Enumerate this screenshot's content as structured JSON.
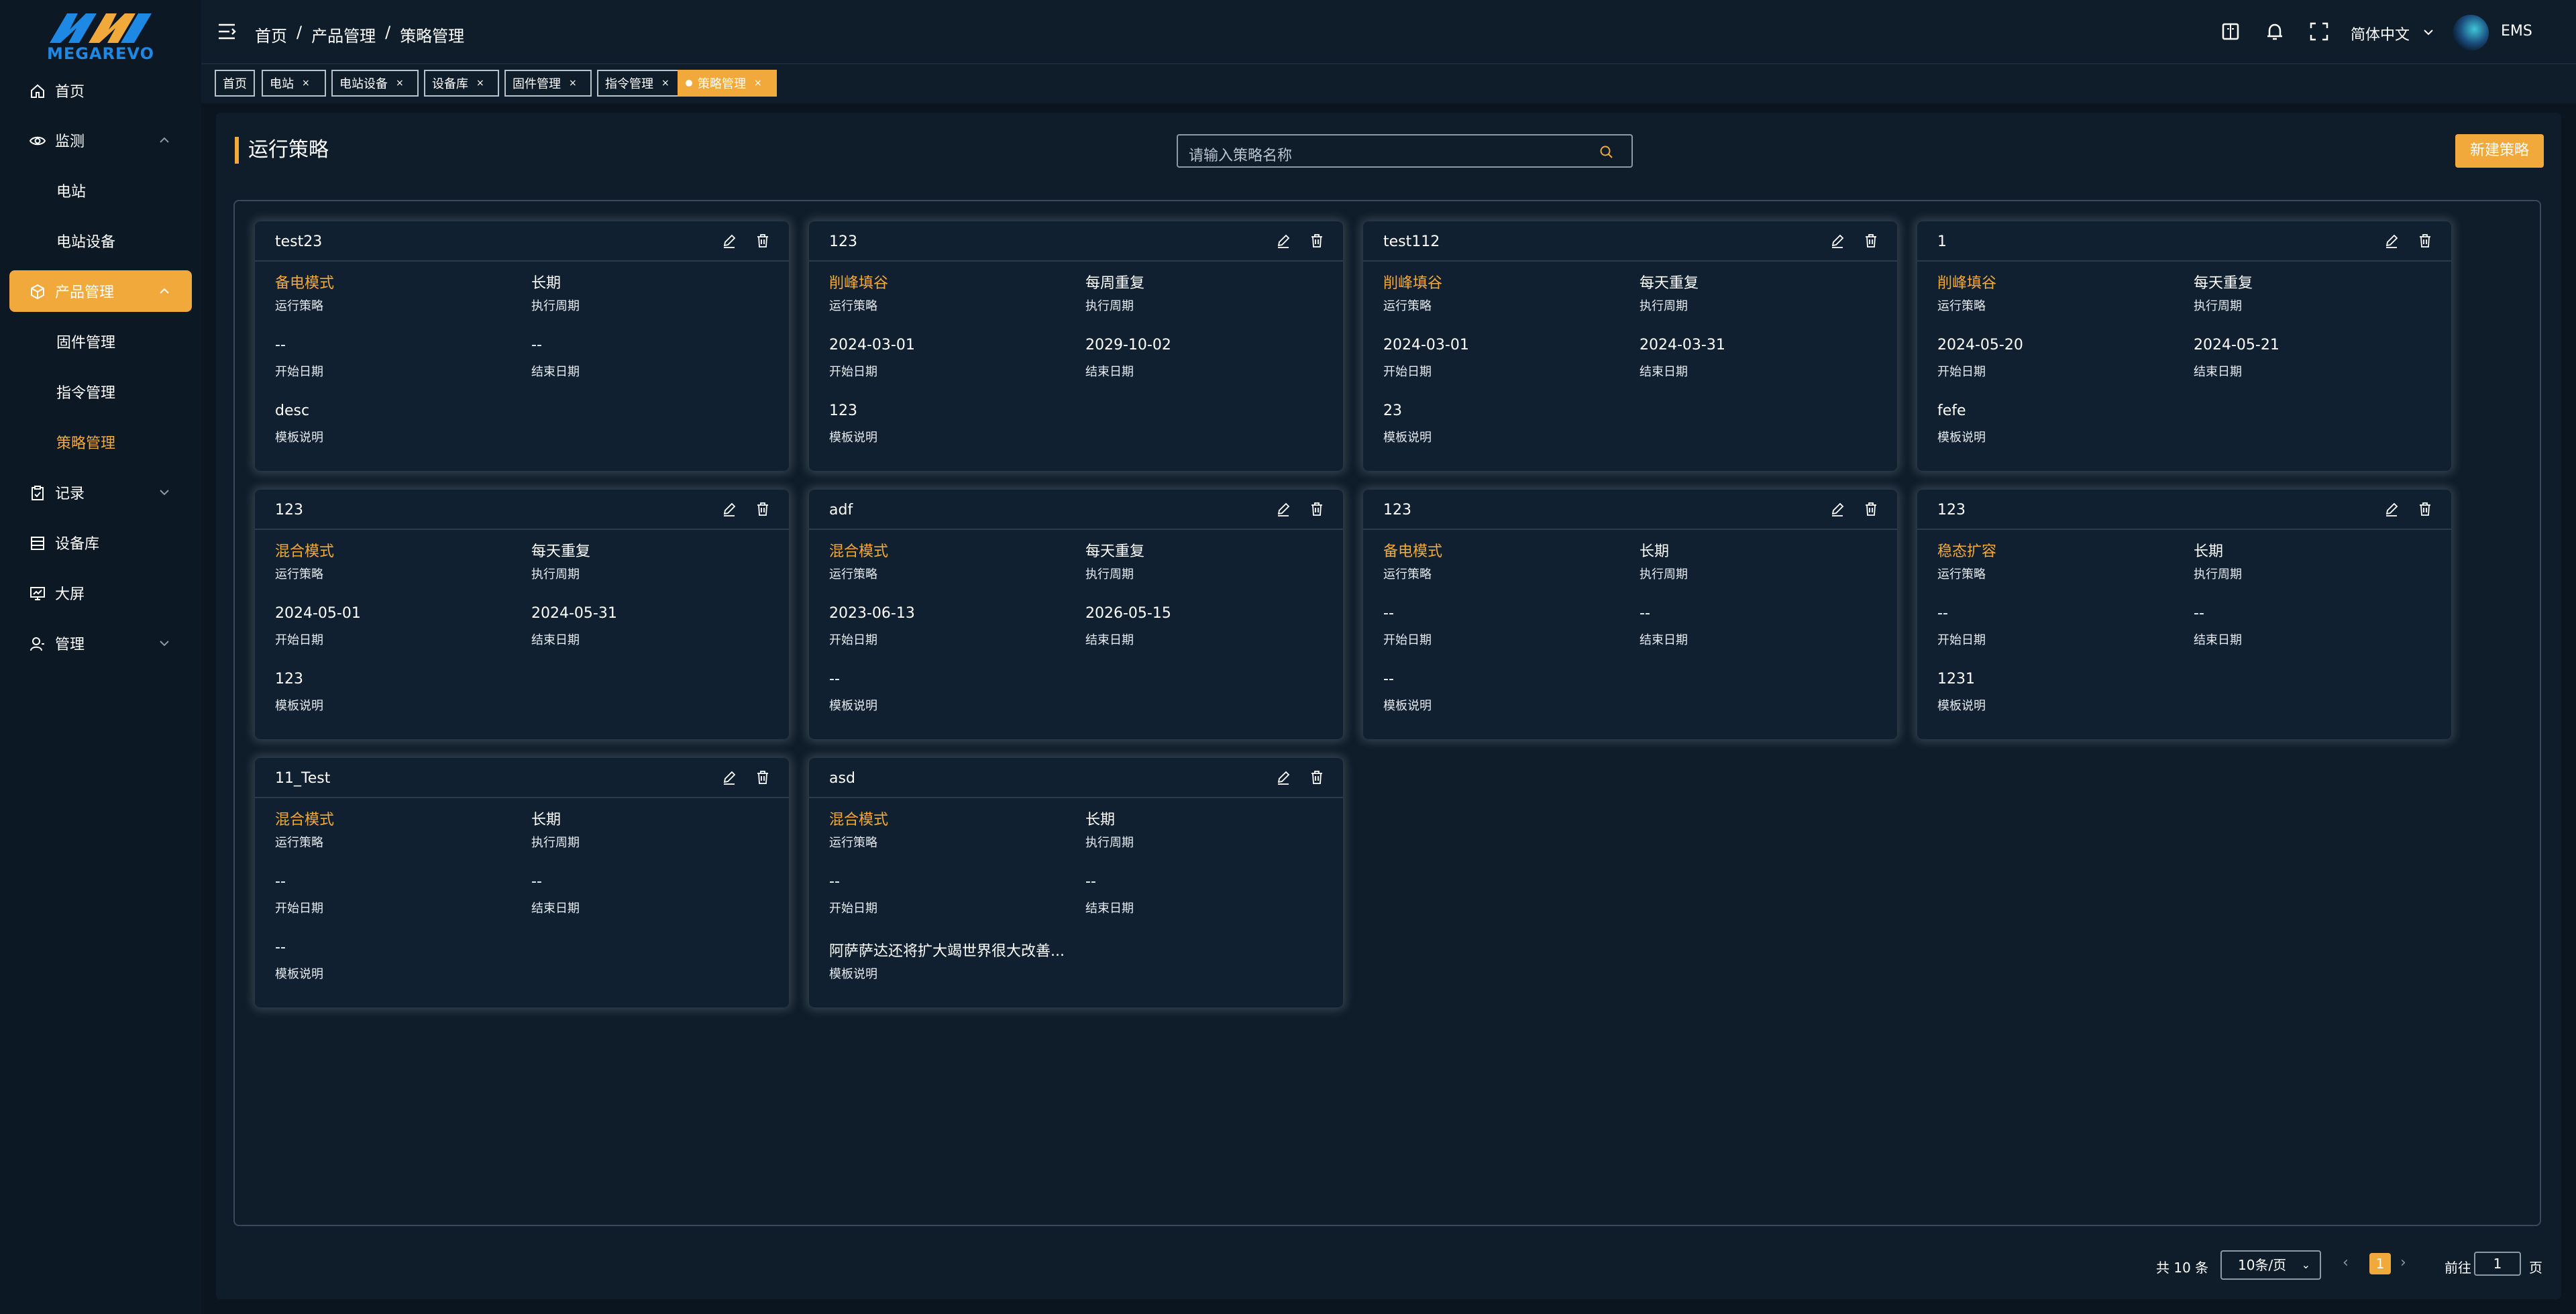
{
  "brand": {
    "logo_text": "MEGAREVO"
  },
  "sidebar": {
    "items": [
      {
        "label": "首页",
        "icon": "home-icon"
      },
      {
        "label": "监测",
        "icon": "eye-icon"
      },
      {
        "label": "电站"
      },
      {
        "label": "电站设备"
      },
      {
        "label": "产品管理",
        "icon": "box-icon"
      },
      {
        "label": "固件管理"
      },
      {
        "label": "指令管理"
      },
      {
        "label": "策略管理"
      },
      {
        "label": "记录",
        "icon": "clipboard-icon"
      },
      {
        "label": "设备库",
        "icon": "database-icon"
      },
      {
        "label": "大屏",
        "icon": "monitor-icon"
      },
      {
        "label": "管理",
        "icon": "user-icon"
      }
    ]
  },
  "header": {
    "breadcrumb": [
      "首页",
      "/",
      "产品管理",
      "/",
      "策略管理"
    ],
    "language": "简体中文",
    "user": "EMS"
  },
  "tabs": [
    {
      "label": "首页",
      "close": ""
    },
    {
      "label": "电站",
      "close": "×"
    },
    {
      "label": "电站设备",
      "close": "×"
    },
    {
      "label": "设备库",
      "close": "×"
    },
    {
      "label": "固件管理",
      "close": "×"
    },
    {
      "label": "指令管理",
      "close": "×"
    },
    {
      "label": "策略管理",
      "close": "×"
    }
  ],
  "page": {
    "title": "运行策略",
    "search_placeholder": "请输入策略名称",
    "new_button": "新建策略"
  },
  "labels": {
    "strategy": "运行策略",
    "cycle": "执行周期",
    "start": "开始日期",
    "end": "结束日期",
    "desc": "模板说明"
  },
  "cards": [
    {
      "name": "test23",
      "strategy": "备电模式",
      "cycle": "长期",
      "start": "--",
      "end": "--",
      "desc": "desc"
    },
    {
      "name": "123",
      "strategy": "削峰填谷",
      "cycle": "每周重复",
      "start": "2024-03-01",
      "end": "2029-10-02",
      "desc": "123"
    },
    {
      "name": "test112",
      "strategy": "削峰填谷",
      "cycle": "每天重复",
      "start": "2024-03-01",
      "end": "2024-03-31",
      "desc": "23"
    },
    {
      "name": "1",
      "strategy": "削峰填谷",
      "cycle": "每天重复",
      "start": "2024-05-20",
      "end": "2024-05-21",
      "desc": "fefe"
    },
    {
      "name": "123",
      "strategy": "混合模式",
      "cycle": "每天重复",
      "start": "2024-05-01",
      "end": "2024-05-31",
      "desc": "123"
    },
    {
      "name": "adf",
      "strategy": "混合模式",
      "cycle": "每天重复",
      "start": "2023-06-13",
      "end": "2026-05-15",
      "desc": "--"
    },
    {
      "name": "123",
      "strategy": "备电模式",
      "cycle": "长期",
      "start": "--",
      "end": "--",
      "desc": "--"
    },
    {
      "name": "123",
      "strategy": "稳态扩容",
      "cycle": "长期",
      "start": "--",
      "end": "--",
      "desc": "1231"
    },
    {
      "name": "11_Test",
      "strategy": "混合模式",
      "cycle": "长期",
      "start": "--",
      "end": "--",
      "desc": "--"
    },
    {
      "name": "asd",
      "strategy": "混合模式",
      "cycle": "长期",
      "start": "--",
      "end": "--",
      "desc": "阿萨萨达还将扩大竭世界很大改善..."
    }
  ],
  "pagination": {
    "total": "共 10 条",
    "page_size": "10条/页",
    "current": "1",
    "goto_label": "前往",
    "goto_value": "1",
    "page_suffix": "页"
  },
  "colors": {
    "accent": "#f2a93b",
    "background": "#0a1520",
    "panel": "#0f1d2b",
    "card": "#112030"
  }
}
